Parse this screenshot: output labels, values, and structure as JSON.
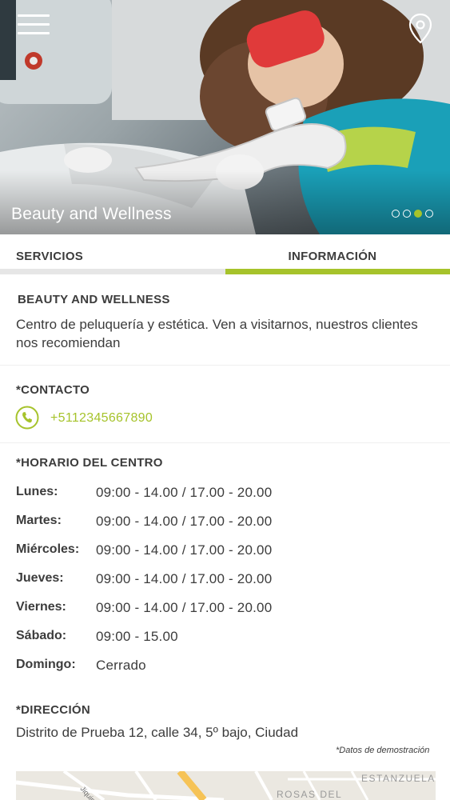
{
  "hero": {
    "title": "Beauty and Wellness",
    "slides_total": 4,
    "active_slide": 3,
    "accent_color": "#a6c32b"
  },
  "header": {
    "menu_icon": "hamburger-menu-icon",
    "location_icon": "map-pin-icon"
  },
  "tabs": [
    {
      "label": "SERVICIOS",
      "active": false
    },
    {
      "label": "INFORMACIÓN",
      "active": true
    }
  ],
  "about": {
    "title": "BEAUTY AND WELLNESS",
    "description": "Centro de peluquería y estética. Ven a visitarnos, nuestros clientes nos recomiendan"
  },
  "contact": {
    "title": "*CONTACTO",
    "phone": "+5112345667890",
    "icon": "phone-icon"
  },
  "schedule": {
    "title": "*HORARIO DEL CENTRO",
    "days": [
      {
        "day": "Lunes:",
        "hours": "09:00 - 14.00  /  17.00 - 20.00"
      },
      {
        "day": "Martes:",
        "hours": "09:00 - 14.00  /  17.00 - 20.00"
      },
      {
        "day": "Miércoles:",
        "hours": "09:00 - 14.00  /  17.00 - 20.00"
      },
      {
        "day": "Jueves:",
        "hours": "09:00 - 14.00  /  17.00 - 20.00"
      },
      {
        "day": "Viernes:",
        "hours": "09:00 - 14.00  /  17.00 - 20.00"
      },
      {
        "day": "Sábado:",
        "hours": "09:00 - 15.00"
      },
      {
        "day": "Domingo:",
        "hours": "Cerrado"
      }
    ]
  },
  "address": {
    "title": "*DIRECCIÓN",
    "text": "Distrito de Prueba 12, calle 34, 5º bajo, Ciudad",
    "demo_note": "*Datos de demostración"
  },
  "map": {
    "labels": [
      "ESTANZUELA",
      "ROSAS DEL",
      "Jiquimbo"
    ]
  }
}
